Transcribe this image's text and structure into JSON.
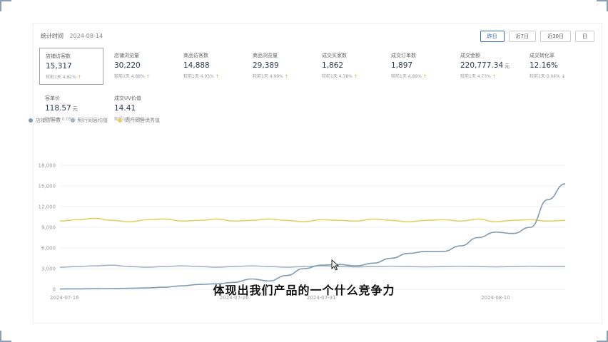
{
  "header": {
    "stat_time_label": "统计时间",
    "stat_date": "2024-08-14",
    "range_buttons": [
      "昨日",
      "近7日",
      "近30日",
      "日"
    ],
    "active_range": 0
  },
  "metrics": [
    {
      "label": "店铺访客数",
      "value": "15,317",
      "unit": "",
      "compare": "较前1天 4.82%",
      "trend": "up",
      "selected": true
    },
    {
      "label": "店铺浏览量",
      "value": "30,220",
      "unit": "",
      "compare": "较前1天 4.88%",
      "trend": "up"
    },
    {
      "label": "商品访客数",
      "value": "14,888",
      "unit": "",
      "compare": "较前1天 4.93%",
      "trend": "up"
    },
    {
      "label": "商品浏览量",
      "value": "29,389",
      "unit": "",
      "compare": "较前1天 4.99%",
      "trend": "up"
    },
    {
      "label": "成交买家数",
      "value": "1,862",
      "unit": "",
      "compare": "较前1天 4.78%",
      "trend": "up"
    },
    {
      "label": "成交订单数",
      "value": "1,897",
      "unit": "",
      "compare": "较前1天 4.89%",
      "trend": "up"
    },
    {
      "label": "成交金额",
      "value": "220,777.34",
      "unit": "元",
      "compare": "较前1天 4.73%",
      "trend": "up"
    },
    {
      "label": "成交转化率",
      "value": "12.16%",
      "unit": "",
      "compare": "较前1天 0.04%",
      "trend": "down"
    },
    {
      "label": "客单价",
      "value": "118.57",
      "unit": "元",
      "compare": "较前1天 0.05%",
      "trend": "down"
    },
    {
      "label": "成交UV价值",
      "value": "14.41",
      "unit": "",
      "compare": "较前1天 0.09%",
      "trend": "down"
    }
  ],
  "chart_data": {
    "type": "line",
    "x": [
      "2024-07-16",
      "2024-07-17",
      "2024-07-18",
      "2024-07-19",
      "2024-07-20",
      "2024-07-21",
      "2024-07-22",
      "2024-07-23",
      "2024-07-24",
      "2024-07-25",
      "2024-07-26",
      "2024-07-27",
      "2024-07-28",
      "2024-07-29",
      "2024-07-30",
      "2024-07-31",
      "2024-08-01",
      "2024-08-02",
      "2024-08-03",
      "2024-08-04",
      "2024-08-05",
      "2024-08-06",
      "2024-08-07",
      "2024-08-08",
      "2024-08-09",
      "2024-08-10",
      "2024-08-11",
      "2024-08-12",
      "2024-08-13",
      "2024-08-14"
    ],
    "x_tick_labels": [
      "2024-07-16",
      "2024-07-26",
      "2024-07-31",
      "2024-08-10"
    ],
    "y_ticks": [
      0,
      3000,
      6000,
      9000,
      12000,
      15000,
      18000
    ],
    "ylim": [
      0,
      18000
    ],
    "series": [
      {
        "name": "店铺访客数",
        "color": "#7f9bb3",
        "values": [
          50,
          60,
          80,
          100,
          150,
          200,
          300,
          500,
          700,
          800,
          1000,
          1500,
          1200,
          2000,
          3000,
          3500,
          3600,
          3400,
          3800,
          4500,
          5200,
          5500,
          5500,
          6300,
          7500,
          8300,
          8100,
          9000,
          13000,
          15317
        ]
      },
      {
        "name": "同行同层均值",
        "color": "#a3b4c4",
        "values": [
          3200,
          3300,
          3400,
          3500,
          3300,
          3200,
          3300,
          3400,
          3300,
          3200,
          3300,
          3400,
          3300,
          3200,
          3300,
          3400,
          3300,
          3250,
          3300,
          3350,
          3300,
          3250,
          3300,
          3350,
          3300,
          3250,
          3300,
          3350,
          3300,
          3300
        ]
      },
      {
        "name": "同行同层优秀值",
        "color": "#e6cf63",
        "values": [
          9900,
          10100,
          10300,
          10000,
          9800,
          10100,
          10200,
          9900,
          10000,
          10200,
          9900,
          10000,
          10200,
          10000,
          9800,
          10100,
          10000,
          9900,
          10200,
          10000,
          9800,
          10000,
          10100,
          9900,
          10200,
          9800,
          10000,
          10100,
          9900,
          10000
        ]
      }
    ]
  },
  "subtitle": "体现出我们产品的一个什么竞争力"
}
